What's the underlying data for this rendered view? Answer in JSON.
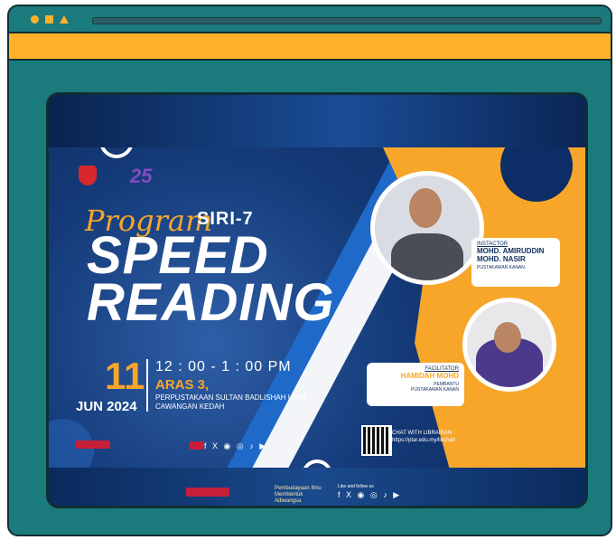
{
  "window": {
    "accent": "#ffb12a",
    "frame_color": "#1b7a7c"
  },
  "poster": {
    "program_script": "Program",
    "series": "SIRI-7",
    "title_line1": "SPEED",
    "title_line2": "READING",
    "day": "11",
    "month_year": "JUN 2024",
    "time": "12 : 00 - 1 : 00 PM",
    "venue": "ARAS 3,",
    "venue_detail": "PERPUSTAKAAN SULTAN BADLISHAH UITM CAWANGAN KEDAH",
    "logo_number": "25",
    "instructor": {
      "role": "INSTACTOR",
      "name_line1": "MOHD. AMIRUDDIN",
      "name_line2": "MOHD. NASIR",
      "position": "PUSTAKAWAN KANAN"
    },
    "facilitator": {
      "role": "FACILITATOR",
      "name": "HAMIDAH MOHD",
      "position_line1": "PEMBANTU",
      "position_line2": "PUSTAKAWAN KANAN"
    },
    "chat_line1": "CHAT WITH LIBRARIAN :",
    "chat_line2": "https://ptar.edu.my/libchat/",
    "social_icons": "f X ◉ ◎ ♪ ▶",
    "footer": {
      "follow_label": "Like and follow us",
      "tagline": "Pembudayaan Ilmu Membentuk Adiwangsa",
      "social_icons": "f X ◉ ◎ ♪ ▶"
    }
  }
}
